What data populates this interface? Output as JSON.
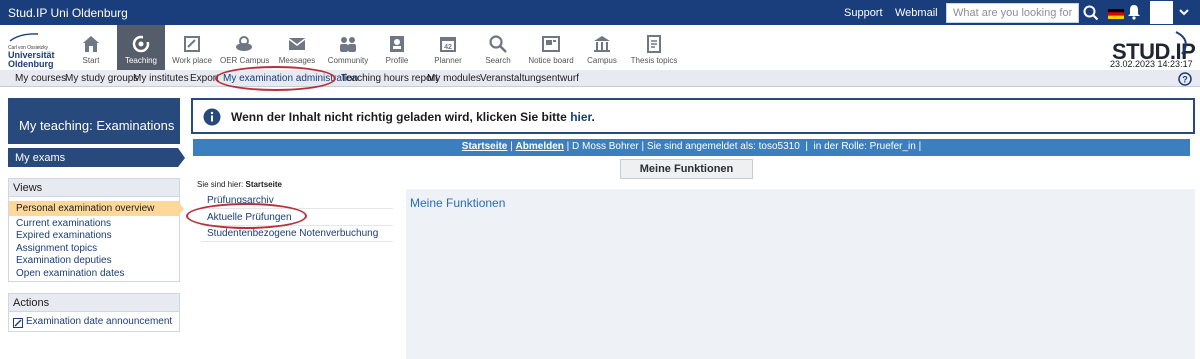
{
  "topbar": {
    "brand": "Stud.IP Uni Oldenburg",
    "support": "Support",
    "webmail": "Webmail",
    "search_placeholder": "What are you looking for?",
    "bar_color": "#1a3d7c"
  },
  "logo": {
    "uni_line1": "Carl von Ossietzky",
    "uni_line2": "Universität",
    "uni_line3": "Oldenburg",
    "studip": "STUD.IP",
    "datetime": "23.02.2023 14:23:17"
  },
  "nav": [
    {
      "label": "Start",
      "icon": "home-icon"
    },
    {
      "label": "Teaching",
      "icon": "teaching-icon",
      "active": true
    },
    {
      "label": "Work place",
      "icon": "workplace-icon"
    },
    {
      "label": "OER Campus",
      "icon": "oer-campus-icon"
    },
    {
      "label": "Messages",
      "icon": "mail-icon"
    },
    {
      "label": "Community",
      "icon": "community-icon"
    },
    {
      "label": "Profile",
      "icon": "profile-icon"
    },
    {
      "label": "Planner",
      "icon": "calendar-icon"
    },
    {
      "label": "Search",
      "icon": "search-icon"
    },
    {
      "label": "Notice board",
      "icon": "notice-board-icon"
    },
    {
      "label": "Campus",
      "icon": "campus-icon"
    },
    {
      "label": "Thesis topics",
      "icon": "thesis-icon"
    }
  ],
  "subnav": [
    {
      "label": "My courses"
    },
    {
      "label": "My study groups"
    },
    {
      "label": "My institutes"
    },
    {
      "label": "Export"
    },
    {
      "label": "My examination administration",
      "active": true
    },
    {
      "label": "Teaching hours report"
    },
    {
      "label": "My modules"
    },
    {
      "label": "Veranstaltungsentwurf"
    }
  ],
  "sidebar": {
    "title": "My teaching: Examinations",
    "current": "My exams",
    "views_header": "Views",
    "views": [
      "Personal examination overview",
      "Current examinations",
      "Expired examinations",
      "Assignment topics",
      "Examination deputies",
      "Open examination dates"
    ],
    "actions_header": "Actions",
    "actions": [
      "Examination date announcement"
    ]
  },
  "info": {
    "text": "Wenn der Inhalt nicht richtig geladen wird, klicken Sie bitte",
    "link": "hier",
    "suffix": "."
  },
  "statusbar": {
    "startseite": "Startseite",
    "abmelden": "Abmelden",
    "user": "D Moss Bohrer",
    "logged_in": "Sie sind angemeldet als: toso5310",
    "role": "in der Rolle: Pruefer_in",
    "sep": "|",
    "color": "#3b7fbf"
  },
  "main": {
    "functions_button": "Meine Funktionen",
    "breadcrumb_label": "Sie sind hier:",
    "breadcrumb_value": "Startseite",
    "menu": [
      "Prüfungsarchiv",
      "Aktuelle Prüfungen",
      "Studentenbezogene Notenverbuchung"
    ],
    "panel_title": "Meine Funktionen"
  },
  "annotation_color": "#b5323c"
}
